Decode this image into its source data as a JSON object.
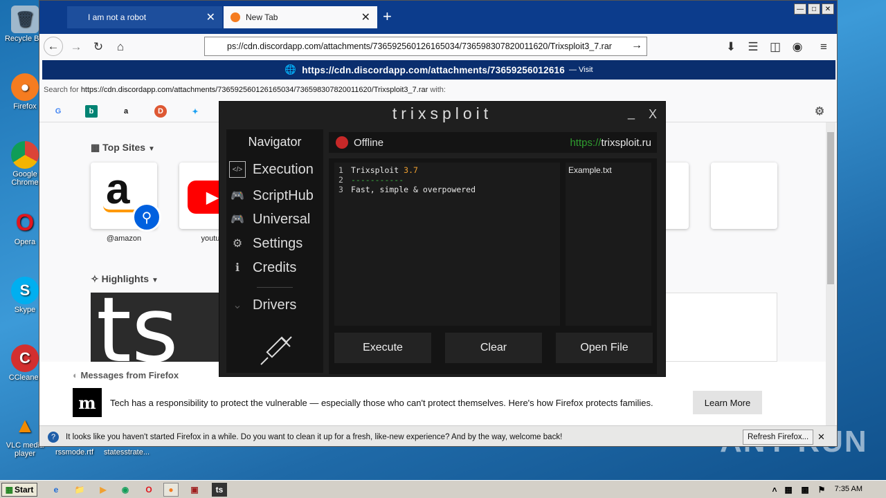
{
  "desktop": {
    "icons": [
      "Recycle Bin",
      "Firefox",
      "Google Chrome",
      "Opera",
      "Skype",
      "CCleaner",
      "VLC media player"
    ],
    "bottom_files": [
      "rssmode.rtf",
      "statesstrate..."
    ]
  },
  "browser": {
    "tabs": [
      {
        "label": "I am not a robot"
      },
      {
        "label": "New Tab"
      }
    ],
    "url": "ps://cdn.discordapp.com/attachments/736592560126165034/736598307820011620/Trixsploit3_7.rar",
    "visit_url": "https://cdn.discordapp.com/attachments/73659256012616",
    "visit_label": "— Visit",
    "search_for_prefix": "Search for",
    "search_for_url": "https://cdn.discordapp.com/attachments/736592560126165034/736598307820011620/Trixsploit3_7.rar",
    "search_for_suffix": "with:",
    "top_sites_label": "Top Sites",
    "highlights_label": "Highlights",
    "tiles": [
      {
        "label": "@amazon"
      },
      {
        "label": "youtub"
      }
    ],
    "messages_label": "Messages from Firefox",
    "message_text": "Tech has a responsibility to protect the vulnerable — especially those who can't protect themselves. Here's how Firefox protects families.",
    "learn_more": "Learn More",
    "bottom_notice": "It looks like you haven't started Firefox in a while. Do you want to clean it up for a fresh, like-new experience? And by the way, welcome back!",
    "refresh_button": "Refresh Firefox..."
  },
  "trixsploit": {
    "title": "trixsploit",
    "minimize": "_",
    "close": "X",
    "nav_title": "Navigator",
    "nav_items": [
      "Execution",
      "ScriptHub",
      "Universal",
      "Settings",
      "Credits",
      "Drivers"
    ],
    "status": "Offline",
    "link_scheme": "https://",
    "link_host": "trixsploit.ru",
    "code_lines": [
      {
        "num": "1",
        "text": "Trixsploit ",
        "version": "3.7"
      },
      {
        "num": "2",
        "text": "-----------"
      },
      {
        "num": "3",
        "text": "Fast, simple & overpowered"
      }
    ],
    "files": [
      "Example.txt"
    ],
    "buttons": {
      "execute": "Execute",
      "clear": "Clear",
      "open_file": "Open File"
    }
  },
  "taskbar": {
    "start": "Start",
    "clock": "7:35 AM"
  },
  "watermark": "ANY RUN"
}
